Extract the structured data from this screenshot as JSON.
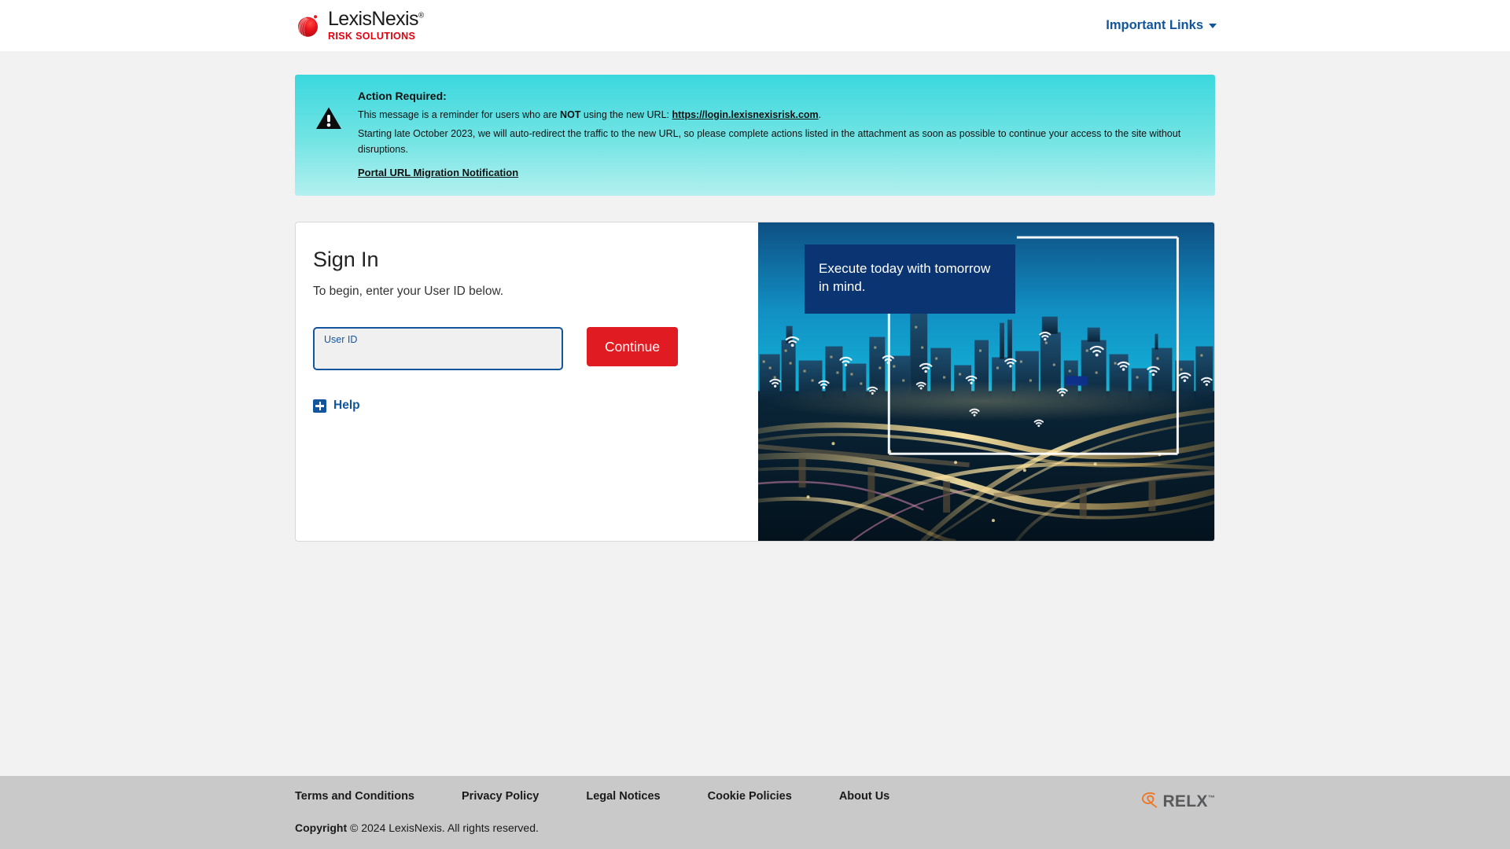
{
  "header": {
    "logo": {
      "wordmark": "LexisNexis",
      "registered_mark": "®",
      "tagline": "RISK SOLUTIONS",
      "mark_icon": "lexisnexis-sphere-icon"
    },
    "important_links": {
      "label": "Important Links",
      "caret_icon": "chevron-down-icon"
    }
  },
  "alert": {
    "icon": "warning-triangle-icon",
    "title": "Action Required:",
    "line1_pre": "This message is a reminder for users who are ",
    "line1_bold": "NOT",
    "line1_mid": " using the new URL: ",
    "line1_url": "https://login.lexisnexisrisk.com",
    "line1_post": ".",
    "line2": "Starting late October 2023, we will auto-redirect the traffic to the new URL, so please complete actions listed in the attachment as soon as possible to continue your access to the site without disruptions.",
    "attachment_link": "Portal URL Migration Notification"
  },
  "signin": {
    "title": "Sign In",
    "subtitle": "To begin, enter your User ID below.",
    "user_id_label": "User ID",
    "user_id_value": "",
    "user_id_placeholder": "",
    "continue_label": "Continue",
    "help_label": "Help",
    "help_icon": "plus-square-icon"
  },
  "hero": {
    "caption": "Execute today with tomorrow in mind.",
    "image_alt": "night-cityscape-highway-interchange-image",
    "wifi_icon": "wifi-signal-icon"
  },
  "footer": {
    "links": [
      "Terms and Conditions",
      "Privacy Policy",
      "Legal Notices",
      "Cookie Policies",
      "About Us"
    ],
    "copyright_label": "Copyright",
    "copyright_text": "© 2024 LexisNexis. All rights reserved.",
    "relx": {
      "wordmark": "RELX",
      "trademark": "™",
      "logo_icon": "relx-logo-icon"
    }
  },
  "colors": {
    "brand_red": "#e01b22",
    "brand_blue": "#12559c",
    "alert_cyan": "#3ad8de",
    "hero_navy": "#0b3572",
    "footer_gray": "#c9c9c9",
    "page_gray": "#f2f2f2",
    "relx_orange": "#ee7623"
  }
}
